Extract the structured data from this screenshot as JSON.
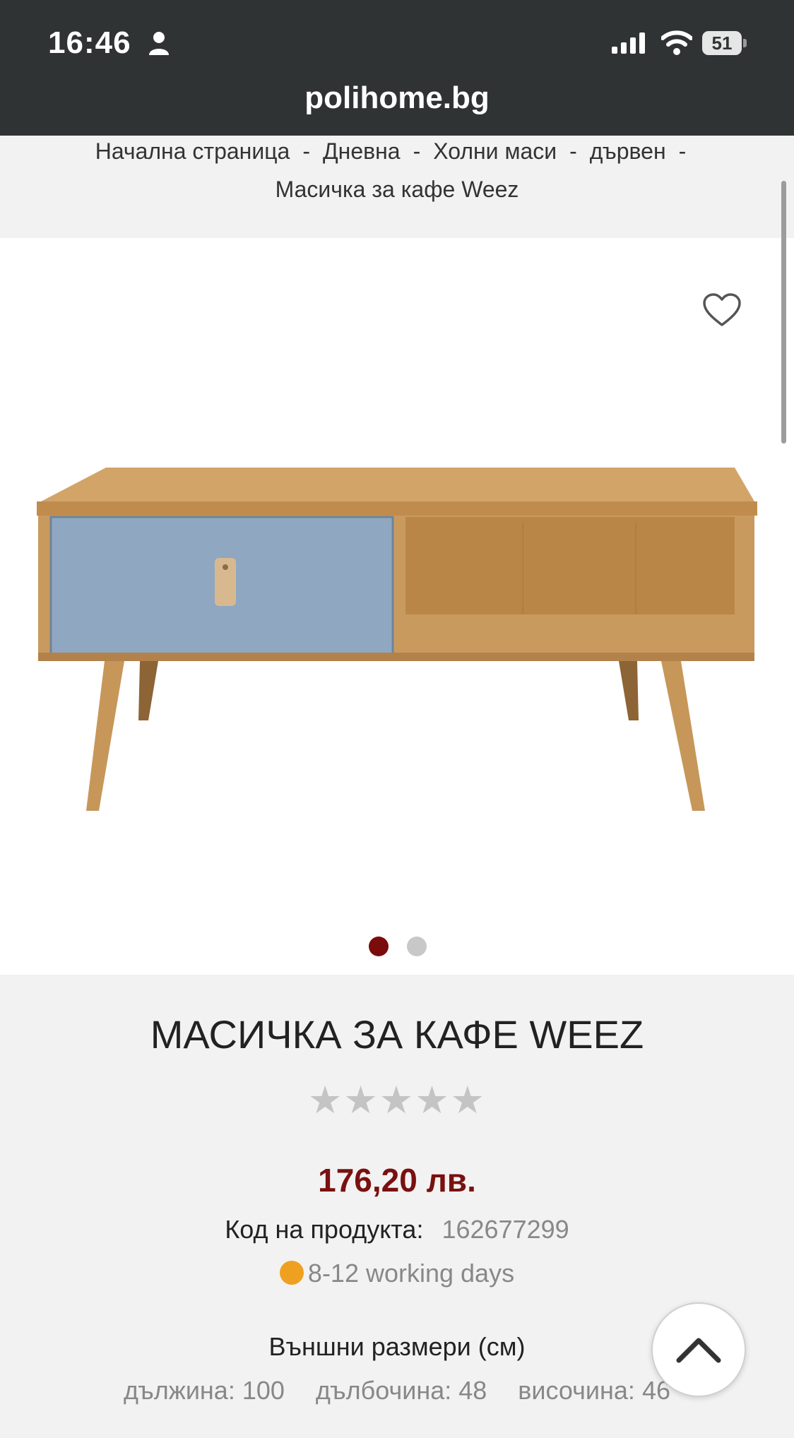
{
  "status_bar": {
    "time": "16:46",
    "battery": "51"
  },
  "browser": {
    "url": "polihome.bg"
  },
  "breadcrumb": {
    "items": [
      "Начална страница",
      "Дневна",
      "Холни маси",
      "дървен",
      "Масичка за кафе Weez"
    ],
    "separator": "-"
  },
  "gallery": {
    "slides": 2,
    "active_slide": 1
  },
  "product": {
    "title": "МАСИЧКА ЗА КАФЕ WEEZ",
    "rating_stars": "★★★★★",
    "rating_value": 0,
    "price": "176,20 лв.",
    "code_label": "Код на продукта:",
    "code_value": "162677299",
    "delivery": "8-12 working days",
    "dimensions_title": "Външни размери (см)",
    "dimensions": {
      "length": "дължина: 100",
      "depth": "дълбочина: 48",
      "height": "височина: 46"
    }
  },
  "colors": {
    "header_bg": "#2f3333",
    "price": "#7a1010",
    "active_dot": "#7a0c0c",
    "delivery_status": "#f0a020",
    "drawer_front": "#8fa7c0",
    "wood": "#c99a5e"
  }
}
